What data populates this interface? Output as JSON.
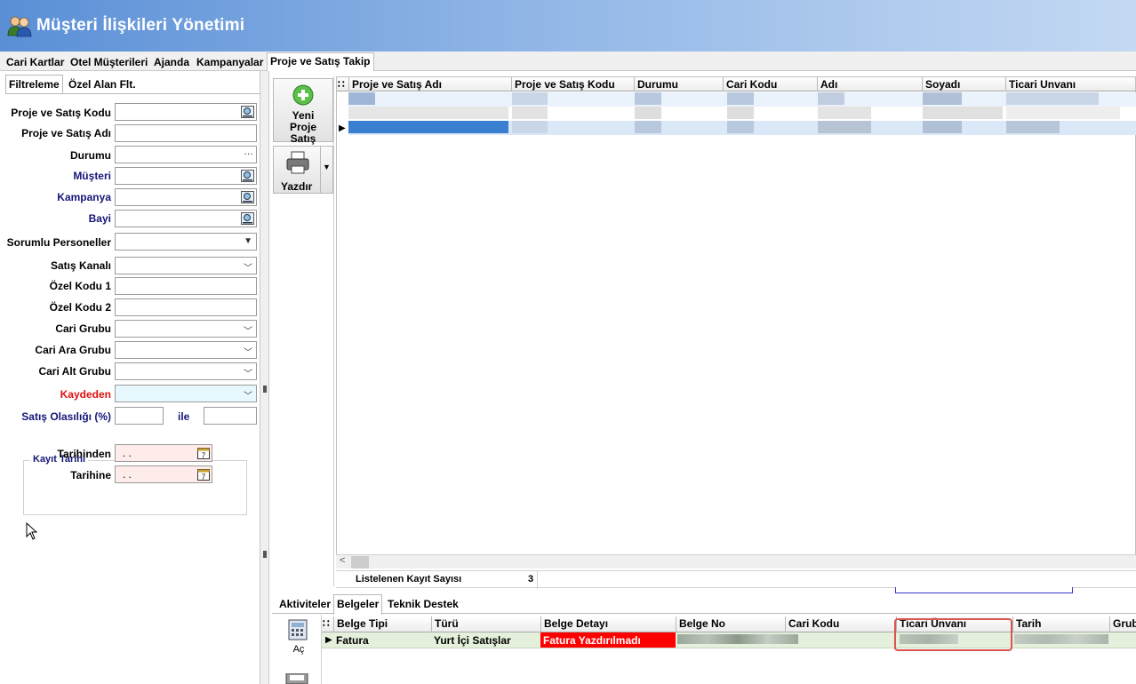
{
  "window": {
    "title": "Müşteri İlişkileri Yönetimi",
    "icon": "users-icon"
  },
  "main_tabs": [
    {
      "label": "Cari Kartlar"
    },
    {
      "label": "Otel Müşterileri"
    },
    {
      "label": "Ajanda"
    },
    {
      "label": "Kampanyalar"
    },
    {
      "label": "Proje ve Satış Takip",
      "active": true
    }
  ],
  "filter_tabs": [
    {
      "label": "Filtreleme",
      "active": true
    },
    {
      "label": "Özel Alan Flt."
    }
  ],
  "filters": {
    "proje_kodu": {
      "label": "Proje ve Satış Kodu",
      "value": ""
    },
    "proje_adi": {
      "label": "Proje ve Satış Adı",
      "value": ""
    },
    "durumu": {
      "label": "Durumu",
      "value": ""
    },
    "musteri": {
      "label": "Müşteri",
      "value": ""
    },
    "kampanya": {
      "label": "Kampanya",
      "value": ""
    },
    "bayi": {
      "label": "Bayi",
      "value": ""
    },
    "sorumlu": {
      "label": "Sorumlu Personeller",
      "value": ""
    },
    "satis_kanali": {
      "label": "Satış Kanalı",
      "value": ""
    },
    "ozel_kodu_1": {
      "label": "Özel Kodu 1",
      "value": ""
    },
    "ozel_kodu_2": {
      "label": "Özel Kodu 2",
      "value": ""
    },
    "cari_grubu": {
      "label": "Cari Grubu",
      "value": ""
    },
    "cari_ara_grubu": {
      "label": "Cari Ara Grubu",
      "value": ""
    },
    "cari_alt_grubu": {
      "label": "Cari Alt Grubu",
      "value": ""
    },
    "kaydeden": {
      "label": "Kaydeden",
      "value": ""
    },
    "satis_olasiligi": {
      "label": "Satış Olasılığı (%)",
      "and_label": "ile",
      "from": "",
      "to": ""
    },
    "kayit_tarihi": {
      "legend": "Kayıt Tarihi",
      "from_label": "Tarihinden",
      "to_label": "Tarihine",
      "from_value": ". .",
      "to_value": ". .",
      "calendar_day": "7"
    }
  },
  "tools": {
    "new_label": "Yeni Proje Satış",
    "print_label": "Yazdır"
  },
  "grid": {
    "columns": [
      "Proje ve Satış Adı",
      "Proje ve Satış Kodu",
      "Durumu",
      "Cari Kodu",
      "Adı",
      "Soyadı",
      "Ticari Unvanı"
    ],
    "row_count": 3,
    "count_label": "Listelenen Kayıt Sayısı",
    "count_value": "3"
  },
  "bottom_tabs": [
    {
      "label": "Aktiviteler"
    },
    {
      "label": "Belgeler",
      "active": true
    },
    {
      "label": "Teknik Destek"
    }
  ],
  "bottom_tools": {
    "open_label": "Aç"
  },
  "documents": {
    "columns": [
      "Belge Tipi",
      "Türü",
      "Belge Detayı",
      "Belge No",
      "Cari Kodu",
      "Ticari Ünvanı",
      "Tarih",
      "Grub"
    ],
    "rows": [
      {
        "belge_tipi": "Fatura",
        "turu": "Yurt İçi Satışlar",
        "belge_detayi": "Fatura Yazdırılmadı"
      }
    ]
  },
  "colors": {
    "title_gradient_start": "#5a8fd6",
    "selected_row": "#3a7fd0",
    "doc_row_bg": "#e4f0dc",
    "status_red": "#ff0000",
    "highlight_border": "#d9534f"
  }
}
